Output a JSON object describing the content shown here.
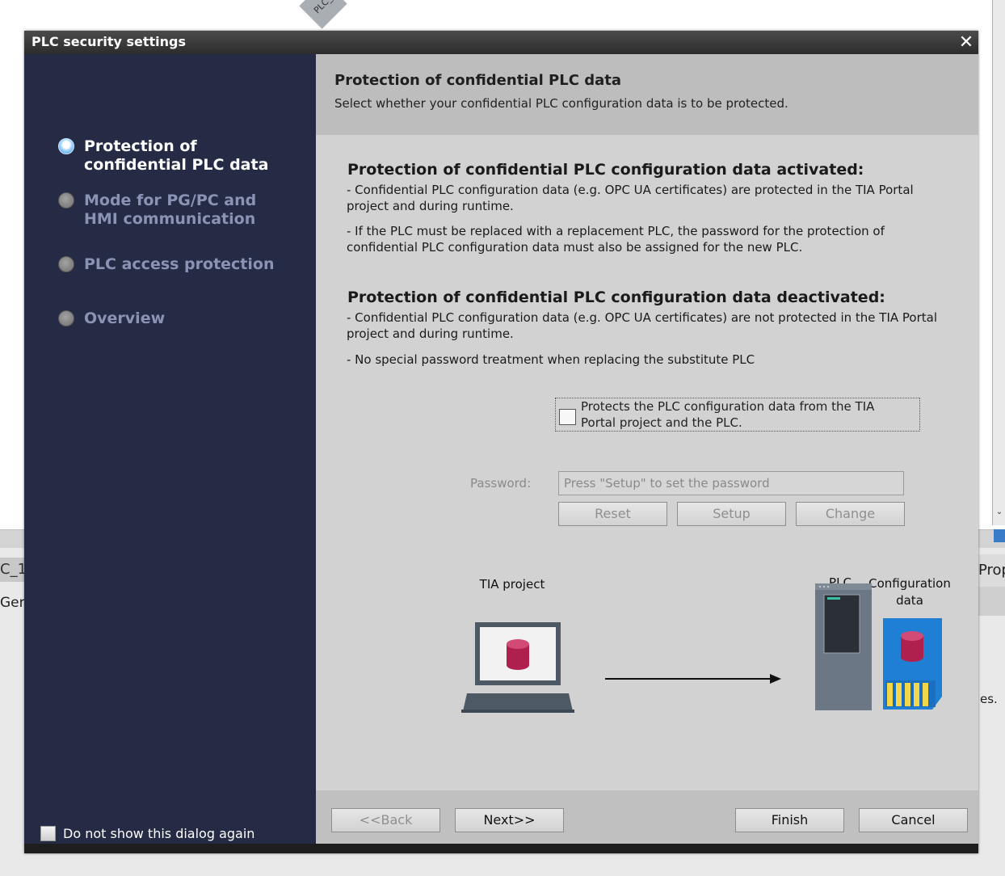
{
  "background": {
    "tag_text": "PLC_",
    "left_tab_text": "C_1",
    "left_tab2_text": "Ger",
    "right_tab_text": "Prop",
    "right_text": "es."
  },
  "dialog": {
    "title": "PLC security settings",
    "nav": {
      "items": [
        {
          "label": "Protection of confidential PLC data",
          "active": true
        },
        {
          "label": "Mode for PG/PC and HMI communication",
          "active": false
        },
        {
          "label": "PLC access protection",
          "active": false
        },
        {
          "label": "Overview",
          "active": false
        }
      ],
      "dont_show_label": "Do not show this dialog again"
    },
    "header": {
      "title": "Protection of confidential PLC data",
      "subtitle": "Select whether your confidential PLC configuration data is to be protected."
    },
    "content": {
      "activated_title": "Protection of confidential PLC configuration data activated:",
      "activated_line1": "- Confidential PLC configuration data (e.g. OPC UA certificates) are protected in the TIA Portal project and during runtime.",
      "activated_line2": "- If the PLC must be replaced with a replacement PLC, the password for the protection of confidential PLC configuration data must also be assigned for the new PLC.",
      "deactivated_title": "Protection of confidential PLC configuration data deactivated:",
      "deactivated_line1": "- Confidential PLC configuration data (e.g. OPC UA certificates) are not protected in the TIA Portal project and during runtime.",
      "deactivated_line2": "- No special password treatment when replacing the substitute PLC",
      "protect_checkbox_label": "Protects the PLC configuration data from the TIA Portal project and the PLC.",
      "protect_checked": false,
      "password_label": "Password:",
      "password_placeholder": "Press \"Setup\" to set the password",
      "password_value": "",
      "reset_label": "Reset",
      "setup_label": "Setup",
      "change_label": "Change"
    },
    "diagram": {
      "tia_label": "TIA project",
      "plc_label": "PLC",
      "config_label": "Configuration data"
    },
    "footer": {
      "back_label": "<<Back",
      "next_label": "Next>>",
      "finish_label": "Finish",
      "cancel_label": "Cancel"
    }
  },
  "colors": {
    "nav_bg": "#262b45",
    "dialog_bg": "#d2d2d2",
    "header_bg": "#bdbdbd",
    "footer_bg": "#c0c0c0",
    "accent_radio": "#3a8fd9",
    "sd_card": "#1e7fd4",
    "db_cylinder": "#b0204f"
  }
}
